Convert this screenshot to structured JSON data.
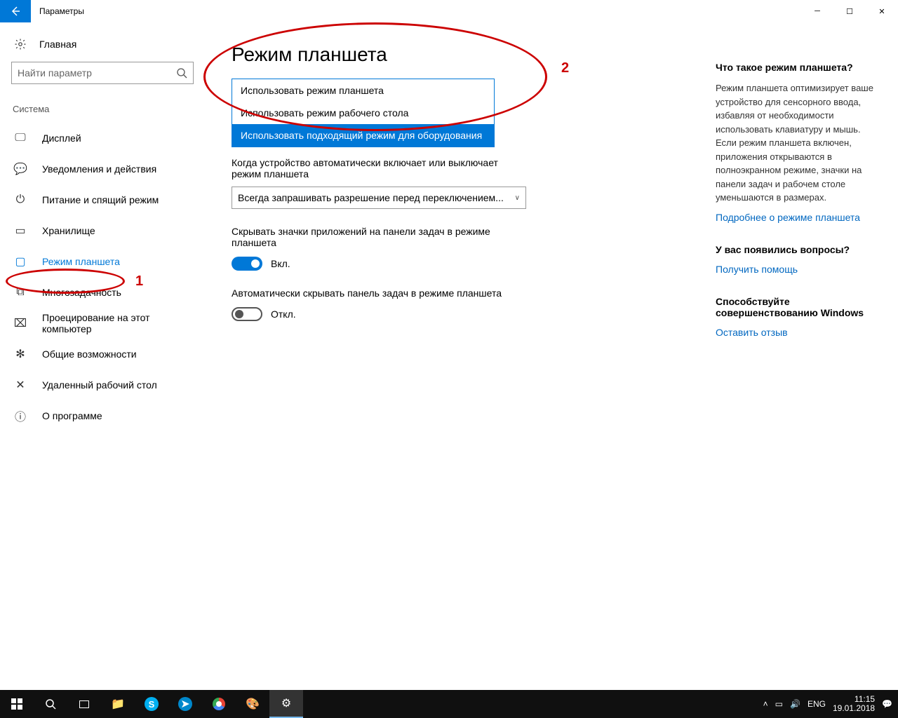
{
  "window_title": "Параметры",
  "home_label": "Главная",
  "search_placeholder": "Найти параметр",
  "category_label": "Система",
  "nav": [
    {
      "label": "Дисплей"
    },
    {
      "label": "Уведомления и действия"
    },
    {
      "label": "Питание и спящий режим"
    },
    {
      "label": "Хранилище"
    },
    {
      "label": "Режим планшета"
    },
    {
      "label": "Многозадачность"
    },
    {
      "label": "Проецирование на этот компьютер"
    },
    {
      "label": "Общие возможности"
    },
    {
      "label": "Удаленный рабочий стол"
    },
    {
      "label": "О программе"
    }
  ],
  "page_heading": "Режим планшета",
  "dropdown_options": [
    "Использовать режим планшета",
    "Использовать режим рабочего стола",
    "Использовать подходящий режим для оборудования"
  ],
  "section2_label": "Когда устройство автоматически включает или выключает режим планшета",
  "section2_value": "Всегда запрашивать разрешение перед переключением...",
  "toggle1_label": "Скрывать значки приложений на панели задач в режиме планшета",
  "toggle1_state": "Вкл.",
  "toggle2_label": "Автоматически скрывать панель задач в режиме планшета",
  "toggle2_state": "Откл.",
  "aside": {
    "h1": "Что такое режим планшета?",
    "p1": "Режим планшета оптимизирует ваше устройство для сенсорного ввода, избавляя от необходимости использовать клавиатуру и мышь. Если режим планшета включен, приложения открываются в полноэкранном режиме, значки на панели задач и рабочем столе уменьшаются в размерах.",
    "link1": "Подробнее о режиме планшета",
    "h2": "У вас появились вопросы?",
    "link2": "Получить помощь",
    "h3": "Способствуйте совершенствованию Windows",
    "link3": "Оставить отзыв"
  },
  "annotations": {
    "num1": "1",
    "num2": "2"
  },
  "taskbar": {
    "lang": "ENG",
    "time": "11:15",
    "date": "19.01.2018"
  }
}
